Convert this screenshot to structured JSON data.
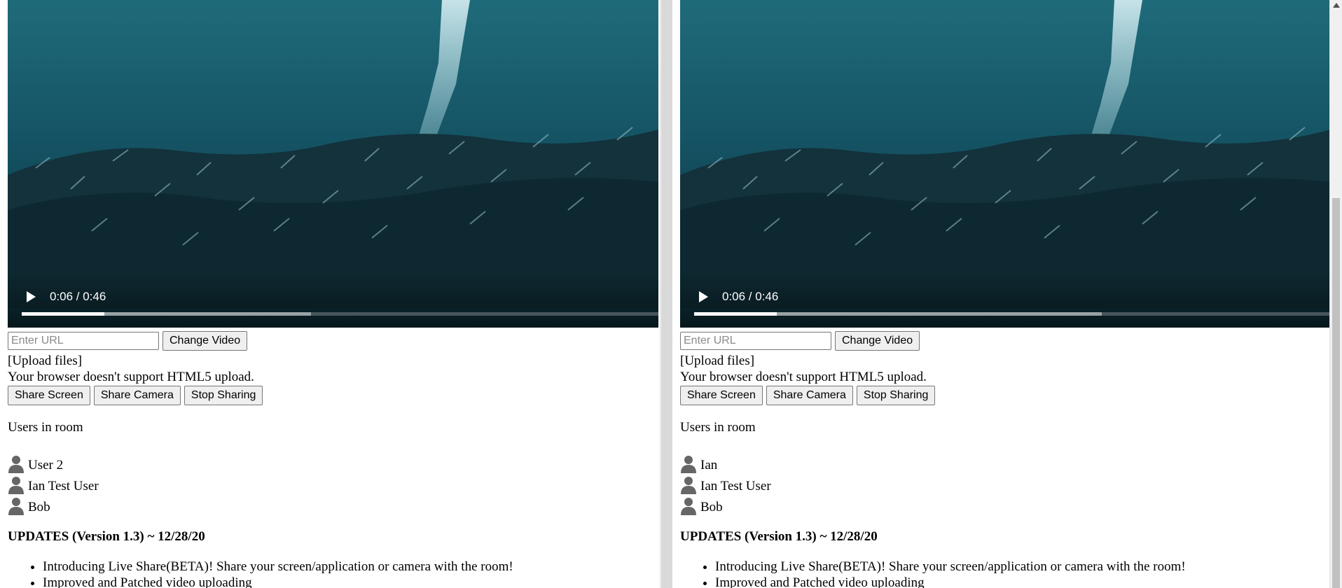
{
  "panes": [
    {
      "id": "left",
      "video": {
        "time_display": "0:06 / 0:46",
        "progress": 0.13,
        "buffered": 0.454
      },
      "url_input": {
        "placeholder": "Enter URL",
        "value": ""
      },
      "change_video_label": "Change Video",
      "upload_link": "[Upload files]",
      "upload_message": "Your browser doesn't support HTML5 upload.",
      "share_buttons": [
        "Share Screen",
        "Share Camera",
        "Stop Sharing"
      ],
      "users_heading": "Users in room",
      "users": [
        "User 2",
        "Ian Test User",
        "Bob"
      ],
      "updates_heading": "UPDATES (Version 1.3) ~ 12/28/20",
      "updates": [
        "Introducing Live Share(BETA)! Share your screen/application or camera with the room!",
        "Improved and Patched video uploading"
      ]
    },
    {
      "id": "right",
      "video": {
        "time_display": "0:06 / 0:46",
        "progress": 0.13,
        "buffered": 0.64
      },
      "url_input": {
        "placeholder": "Enter URL",
        "value": ""
      },
      "change_video_label": "Change Video",
      "upload_link": "[Upload files]",
      "upload_message": "Your browser doesn't support HTML5 upload.",
      "share_buttons": [
        "Share Screen",
        "Share Camera",
        "Stop Sharing"
      ],
      "users_heading": "Users in room",
      "users": [
        "Ian",
        "Ian Test User",
        "Bob"
      ],
      "updates_heading": "UPDATES (Version 1.3) ~ 12/28/20",
      "updates": [
        "Introducing Live Share(BETA)! Share your screen/application or camera with the room!",
        "Improved and Patched video uploading"
      ]
    }
  ],
  "colors": {
    "water_top": "#1f6b7a",
    "water_bottom": "#0b2a33",
    "user_icon": "#666666"
  },
  "icons": {
    "play": "play-icon",
    "user": "user-icon"
  }
}
